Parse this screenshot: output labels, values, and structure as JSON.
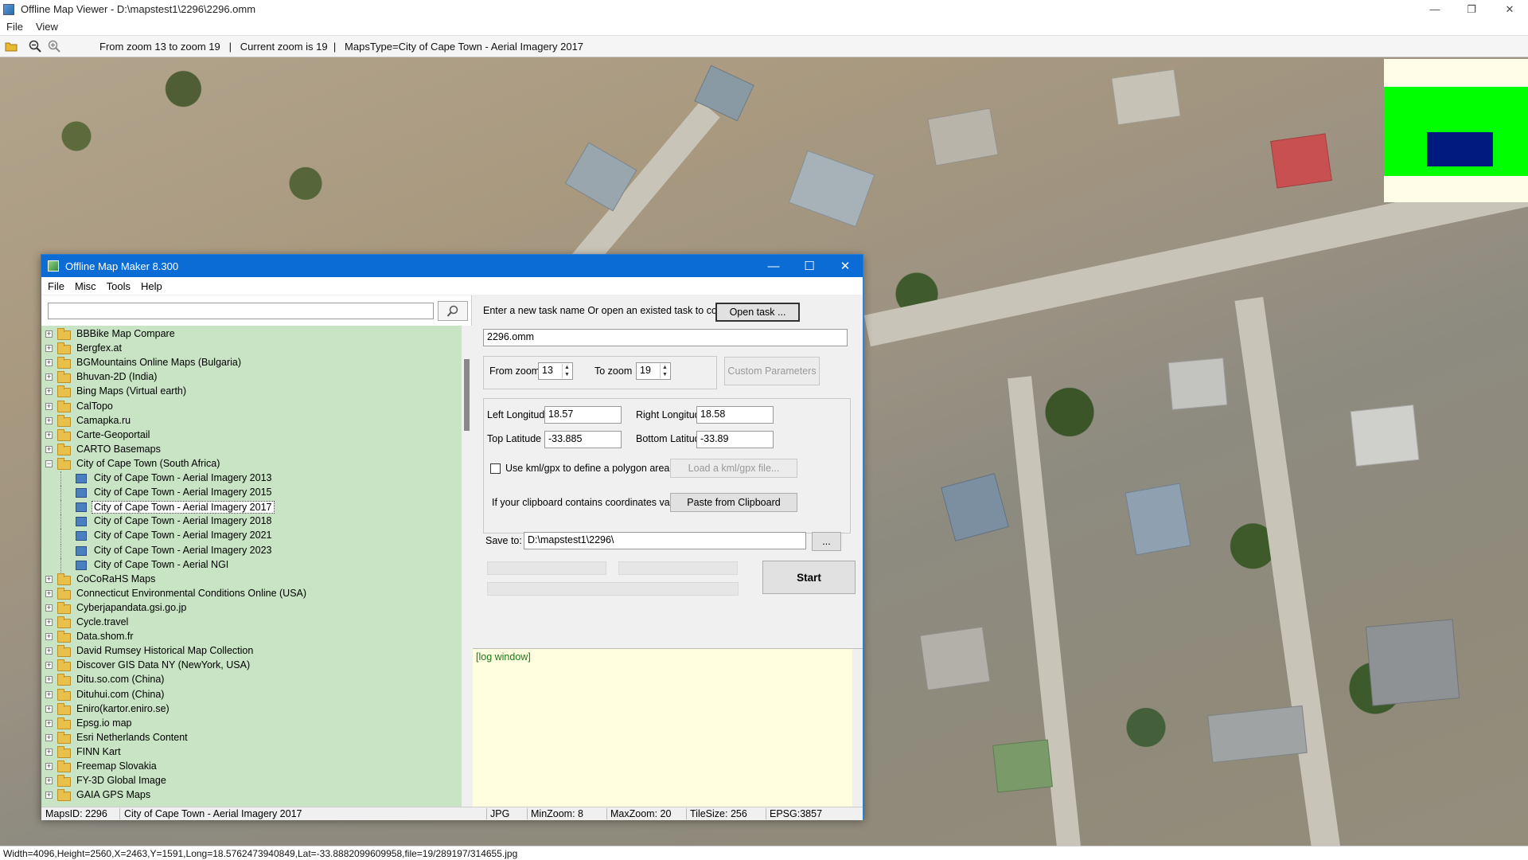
{
  "window": {
    "title": "Offline Map Viewer - D:\\mapstest1\\2296\\2296.omm",
    "menu": [
      "File",
      "View"
    ],
    "controls": {
      "minimize": "—",
      "maximize": "❐",
      "close": "✕"
    }
  },
  "toolbar": {
    "icons": [
      "open-folder-icon",
      "zoom-out-icon",
      "zoom-in-icon"
    ],
    "info": "From zoom 13 to zoom 19   |   Current zoom is 19  |   MapsType=City of Cape Town - Aerial Imagery 2017"
  },
  "statusbar": {
    "text": "Width=4096,Height=2560,X=2463,Y=1591,Long=18.5762473940849,Lat=-33.8882099609958,file=19/289197/314655.jpg"
  },
  "dialog": {
    "title": "Offline Map Maker 8.300",
    "controls": {
      "minimize": "—",
      "maximize": "☐",
      "close": "✕"
    },
    "menu": [
      "File",
      "Misc",
      "Tools",
      "Help"
    ],
    "search": {
      "value": "",
      "icon": "search-icon"
    },
    "tree": [
      {
        "label": "BBBike Map Compare",
        "type": "folder"
      },
      {
        "label": "Bergfex.at",
        "type": "folder"
      },
      {
        "label": "BGMountains Online Maps (Bulgaria)",
        "type": "folder"
      },
      {
        "label": "Bhuvan-2D (India)",
        "type": "folder"
      },
      {
        "label": "Bing Maps (Virtual earth)",
        "type": "folder"
      },
      {
        "label": "CalTopo",
        "type": "folder"
      },
      {
        "label": "Camapka.ru",
        "type": "folder"
      },
      {
        "label": "Carte-Geoportail",
        "type": "folder"
      },
      {
        "label": "CARTO Basemaps",
        "type": "folder"
      },
      {
        "label": "City of Cape Town (South Africa)",
        "type": "folder-open"
      },
      {
        "label": "City of Cape Town - Aerial Imagery 2013",
        "type": "leaf"
      },
      {
        "label": "City of Cape Town - Aerial Imagery 2015",
        "type": "leaf"
      },
      {
        "label": "City of Cape Town - Aerial Imagery 2017",
        "type": "leaf",
        "selected": true
      },
      {
        "label": "City of Cape Town - Aerial Imagery 2018",
        "type": "leaf"
      },
      {
        "label": "City of Cape Town - Aerial Imagery 2021",
        "type": "leaf"
      },
      {
        "label": "City of Cape Town - Aerial Imagery 2023",
        "type": "leaf"
      },
      {
        "label": "City of Cape Town - Aerial NGI",
        "type": "leaf"
      },
      {
        "label": "CoCoRaHS Maps",
        "type": "folder"
      },
      {
        "label": "Connecticut Environmental Conditions Online (USA)",
        "type": "folder"
      },
      {
        "label": "Cyberjapandata.gsi.go.jp",
        "type": "folder"
      },
      {
        "label": "Cycle.travel",
        "type": "folder"
      },
      {
        "label": "Data.shom.fr",
        "type": "folder"
      },
      {
        "label": "David Rumsey Historical Map Collection",
        "type": "folder"
      },
      {
        "label": "Discover GIS Data NY (NewYork, USA)",
        "type": "folder"
      },
      {
        "label": "Ditu.so.com (China)",
        "type": "folder"
      },
      {
        "label": "Dituhui.com (China)",
        "type": "folder"
      },
      {
        "label": "Eniro(kartor.eniro.se)",
        "type": "folder"
      },
      {
        "label": "Epsg.io map",
        "type": "folder"
      },
      {
        "label": "Esri Netherlands Content",
        "type": "folder"
      },
      {
        "label": "FINN Kart",
        "type": "folder"
      },
      {
        "label": "Freemap Slovakia",
        "type": "folder"
      },
      {
        "label": "FY-3D Global Image",
        "type": "folder"
      },
      {
        "label": "GAIA GPS Maps",
        "type": "folder"
      }
    ],
    "task": {
      "prompt": "Enter a new task name Or open an existed task to continue:",
      "open_button": "Open task ...",
      "name": "2296.omm"
    },
    "zoom": {
      "from_label": "From zoom",
      "from_value": "13",
      "to_label": "To zoom",
      "to_value": "19",
      "custom_button": "Custom Parameters"
    },
    "coords": {
      "left_lon_label": "Left Longitude",
      "left_lon": "18.57",
      "right_lon_label": "Right Longitude",
      "right_lon": "18.58",
      "top_lat_label": "Top Latitude",
      "top_lat": "-33.885",
      "bottom_lat_label": "Bottom Latitude",
      "bottom_lat": "-33.89",
      "kml_label": "Use kml/gpx to define a polygon area",
      "kml_button": "Load a kml/gpx file...",
      "clipboard_label": "If your clipboard contains coordinates values:",
      "clipboard_button": "Paste from Clipboard"
    },
    "save": {
      "label": "Save to:",
      "path": "D:\\mapstest1\\2296\\",
      "browse_button": "...",
      "start_button": "Start"
    },
    "log": {
      "text": "[log window]"
    },
    "status": {
      "maps_id": "MapsID: 2296",
      "map_name": "City of Cape Town - Aerial Imagery 2017",
      "format": "JPG",
      "min_zoom": "MinZoom: 8",
      "max_zoom": "MaxZoom: 20",
      "tile_size": "TileSize: 256",
      "epsg": "EPSG:3857"
    }
  },
  "colors": {
    "dialog_title": "#0b6cd6",
    "tree_bg": "#c8e4c4",
    "log_bg": "#ffffe0",
    "overview_green": "#00ff00",
    "overview_blue": "#001a80"
  }
}
